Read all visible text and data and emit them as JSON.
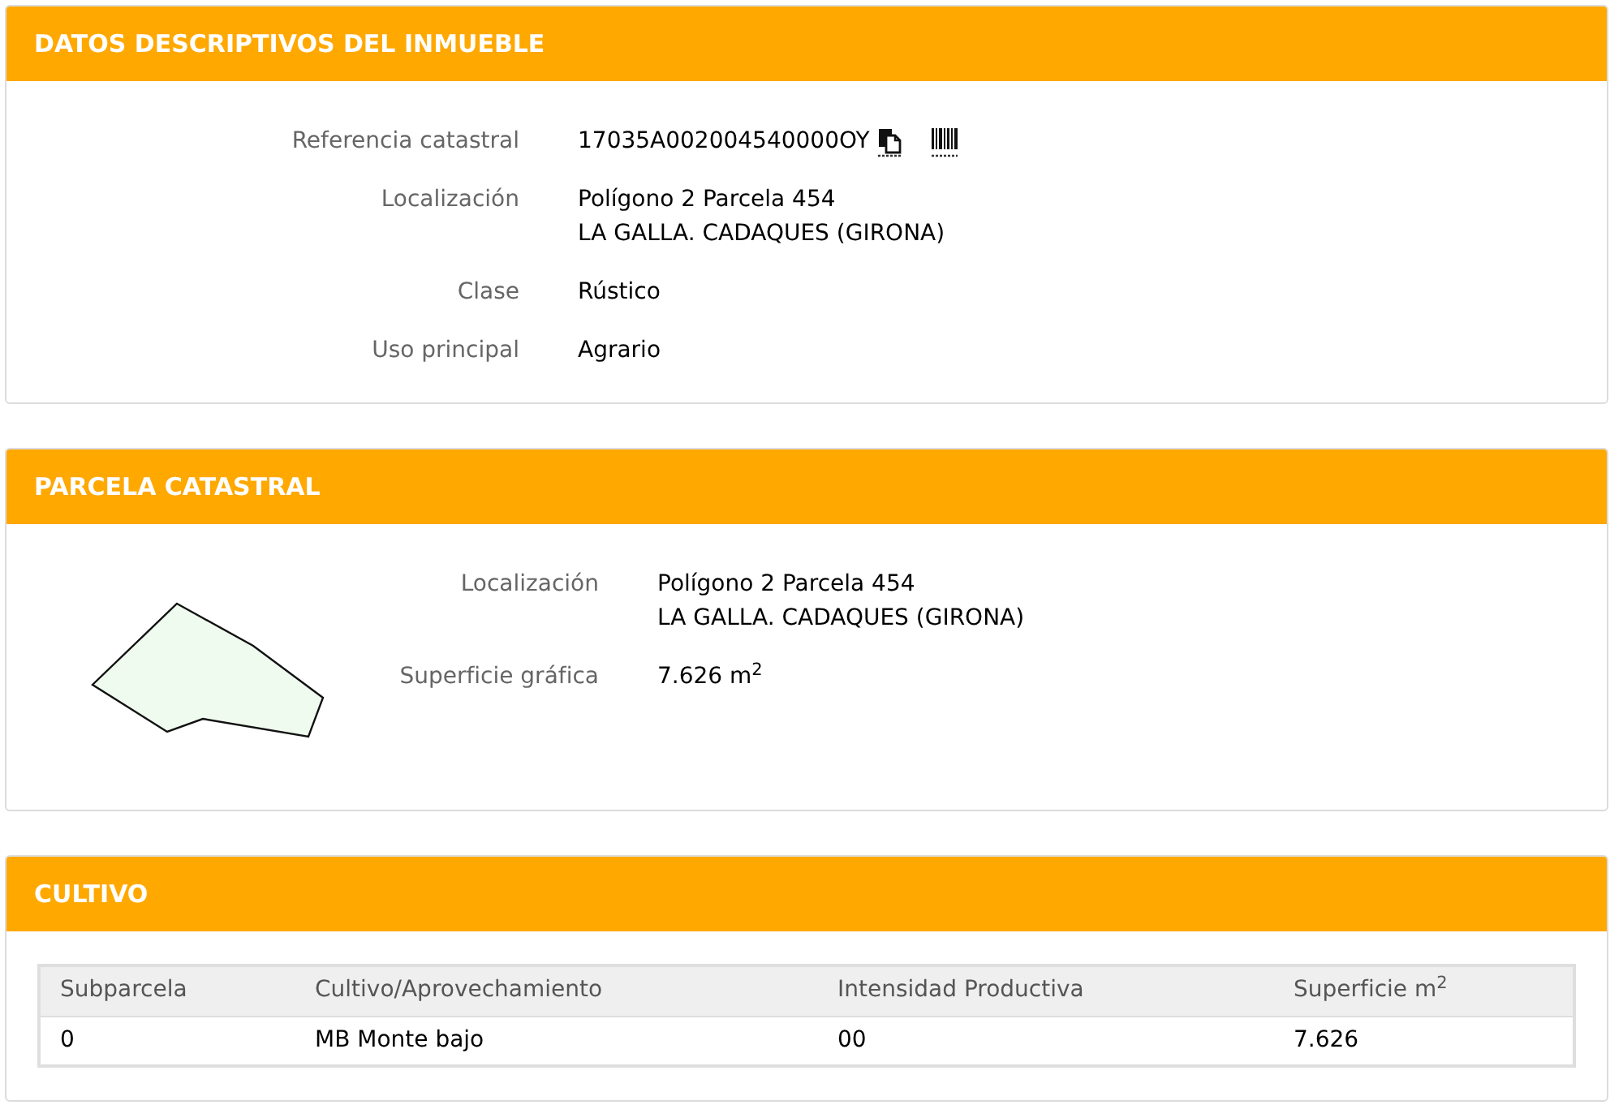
{
  "sections": [
    {
      "kind": "details",
      "title": "DATOS DESCRIPTIVOS DEL INMUEBLE",
      "fields": [
        {
          "kind": "reference",
          "label": "Referencia catastral",
          "lines": [
            "17035A002004540000OY"
          ]
        },
        {
          "kind": "text",
          "label": "Localización",
          "lines": [
            "Polígono 2 Parcela 454",
            "LA GALLA. CADAQUES (GIRONA)"
          ]
        },
        {
          "kind": "text",
          "label": "Clase",
          "lines": [
            "Rústico"
          ]
        },
        {
          "kind": "text",
          "label": "Uso principal",
          "lines": [
            "Agrario"
          ]
        }
      ]
    },
    {
      "kind": "parcel",
      "title": "PARCELA CATASTRAL",
      "fields": [
        {
          "kind": "text",
          "label": "Localización",
          "lines": [
            "Polígono 2 Parcela 454",
            "LA GALLA. CADAQUES (GIRONA)"
          ]
        },
        {
          "kind": "text",
          "label": "Superficie gráfica",
          "lines": [
            "7.626 m$^{2}$"
          ]
        }
      ]
    },
    {
      "kind": "table",
      "title": "CULTIVO",
      "table": {
        "columns": [
          "Subparcela",
          "Cultivo/Aprovechamiento",
          "Intensidad Productiva",
          "Superficie m$^{2}$"
        ],
        "rows": [
          [
            "0",
            "MB Monte bajo",
            "00",
            "7.626"
          ]
        ]
      }
    }
  ]
}
